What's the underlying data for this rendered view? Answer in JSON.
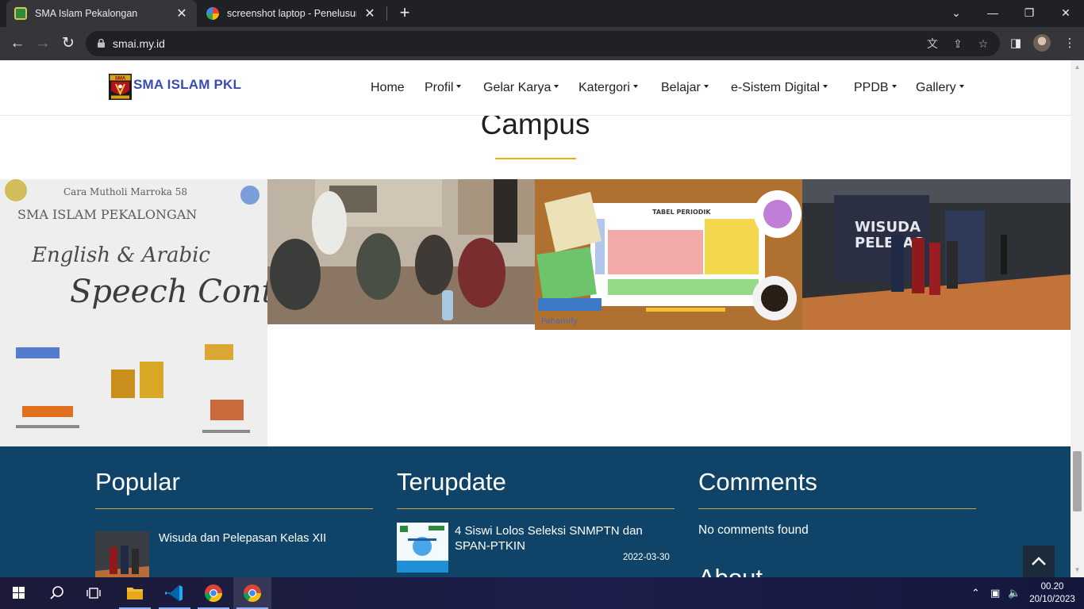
{
  "browser": {
    "tabs": [
      {
        "title": "SMA Islam Pekalongan",
        "active": true
      },
      {
        "title": "screenshot laptop - Penelusuran",
        "active": false
      }
    ],
    "url": "smai.my.id"
  },
  "site": {
    "brand": "SMA ISLAM PKL",
    "logo_text": "SMA",
    "nav": [
      {
        "label": "Home",
        "dropdown": false
      },
      {
        "label": "Profil",
        "dropdown": true
      },
      {
        "label": "Gelar Karya",
        "dropdown": true
      },
      {
        "label": "Katergori",
        "dropdown": true
      },
      {
        "label": "Belajar",
        "dropdown": true
      },
      {
        "label": "e-Sistem Digital",
        "dropdown": true
      },
      {
        "label": "PPDB",
        "dropdown": true
      },
      {
        "label": "Gallery",
        "dropdown": true
      }
    ]
  },
  "campus": {
    "title": "Campus",
    "images": [
      {
        "name": "speech-contest-poster",
        "texts": [
          "Cara Mutholi Marroka 58",
          "SMA ISLAM PEKALONGAN",
          "English & Arabic",
          "Speech Contest"
        ]
      },
      {
        "name": "classroom-students-photo"
      },
      {
        "name": "periodic-table-illustration",
        "texts": [
          "TABEL PERIODIK",
          "Pahamify"
        ]
      },
      {
        "name": "wisuda-stage-photo",
        "texts": [
          "WISUDA",
          "PELEPAS"
        ]
      }
    ]
  },
  "footer": {
    "popular": {
      "title": "Popular",
      "posts": [
        {
          "title": "Wisuda dan Pelepasan Kelas XII"
        }
      ]
    },
    "terupdate": {
      "title": "Terupdate",
      "posts": [
        {
          "title": "4 Siswi Lolos Seleksi SNMPTN dan SPAN-PTKIN",
          "date": "2022-03-30"
        }
      ]
    },
    "comments": {
      "title": "Comments",
      "empty_text": "No comments found"
    },
    "about_peek": "About"
  },
  "taskbar": {
    "apps": [
      "start",
      "search",
      "task-view",
      "file-explorer",
      "vs-code",
      "chrome",
      "chrome"
    ],
    "time": "00.20",
    "date": "20/10/2023"
  },
  "colors": {
    "footer_bg": "#0f4468",
    "accent_rule": "#f0b400",
    "brand": "#3b4bb5"
  }
}
